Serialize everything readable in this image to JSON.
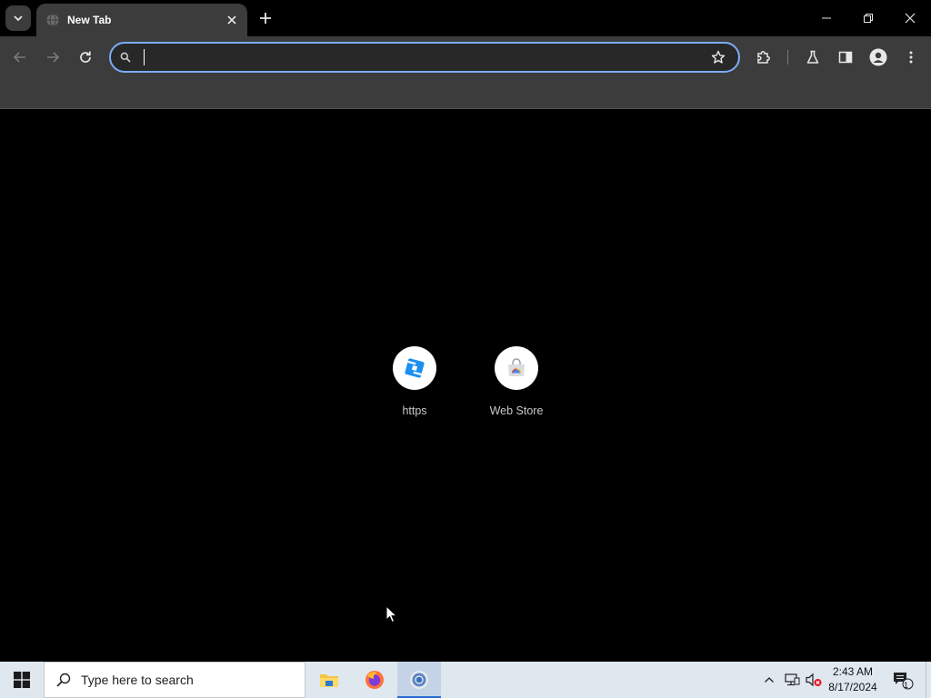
{
  "browser": {
    "tab": {
      "title": "New Tab"
    },
    "omnibox": {
      "value": "",
      "placeholder": ""
    },
    "accent_color": "#7cacf8"
  },
  "shortcuts": [
    {
      "label": "https",
      "icon": "roblox-icon"
    },
    {
      "label": "Web Store",
      "icon": "chrome-web-store-icon"
    }
  ],
  "taskbar": {
    "search_placeholder": "Type here to search",
    "apps": [
      "file-explorer-icon",
      "firefox-icon",
      "chrome-icon"
    ],
    "clock": {
      "time": "2:43 AM",
      "date": "8/17/2024"
    },
    "notification_count": "1"
  }
}
